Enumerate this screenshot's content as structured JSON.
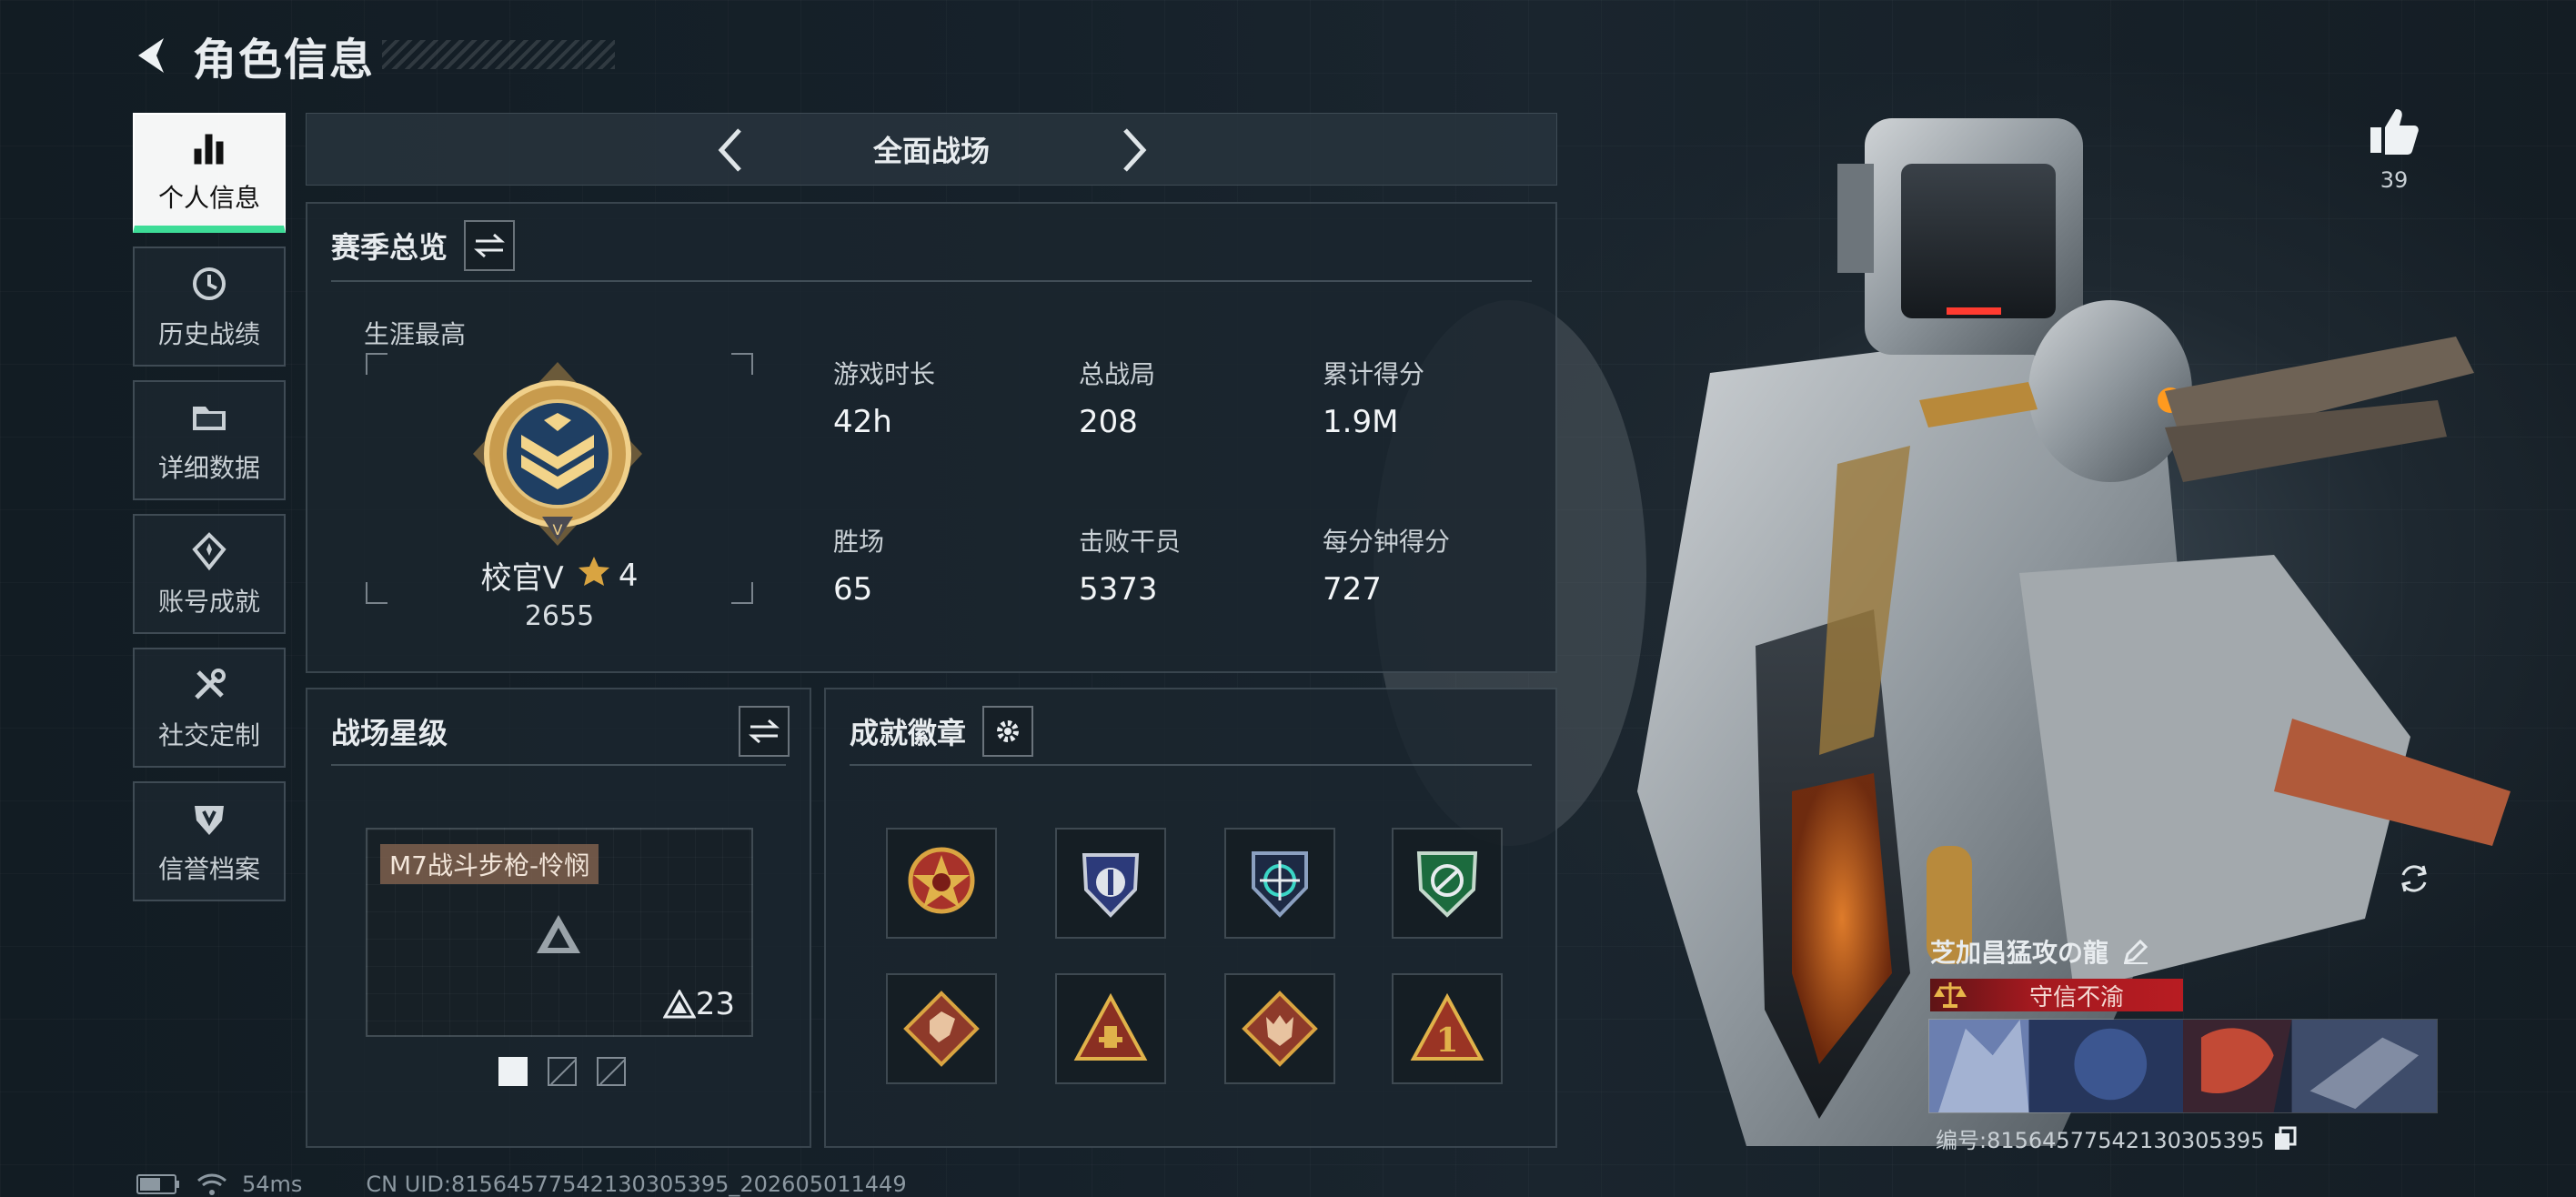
{
  "header": {
    "title": "角色信息"
  },
  "nav": {
    "items": [
      {
        "label": "个人信息",
        "icon": "bar-chart-icon"
      },
      {
        "label": "历史战绩",
        "icon": "history-icon"
      },
      {
        "label": "详细数据",
        "icon": "folder-icon"
      },
      {
        "label": "账号成就",
        "icon": "achievement-icon"
      },
      {
        "label": "社交定制",
        "icon": "tools-icon"
      },
      {
        "label": "信誉档案",
        "icon": "shield-icon"
      }
    ],
    "active_index": 0
  },
  "mode": {
    "title": "全面战场"
  },
  "season": {
    "title": "赛季总览",
    "career_label": "生涯最高",
    "rank": {
      "name": "校官V",
      "stars": "4",
      "points": "2655"
    },
    "stats": [
      {
        "label": "游戏时长",
        "value": "42h"
      },
      {
        "label": "总战局",
        "value": "208"
      },
      {
        "label": "累计得分",
        "value": "1.9M"
      },
      {
        "label": "胜场",
        "value": "65"
      },
      {
        "label": "击败干员",
        "value": "5373"
      },
      {
        "label": "每分钟得分",
        "value": "727"
      }
    ]
  },
  "star_panel": {
    "title": "战场星级",
    "weapon": {
      "name": "M7战斗步枪-怜悯",
      "level": "23"
    },
    "pager": {
      "count": 3,
      "active": 0
    }
  },
  "badges": {
    "title": "成就徽章",
    "items": [
      {
        "icon": "gold-star-medal-icon"
      },
      {
        "icon": "police-shield-badge-icon"
      },
      {
        "icon": "crosshair-shield-badge-icon"
      },
      {
        "icon": "green-shield-badge-icon"
      },
      {
        "icon": "dragon-diamond-badge-icon"
      },
      {
        "icon": "triangle-rank-badge-icon"
      },
      {
        "icon": "wolf-diamond-badge-icon"
      },
      {
        "icon": "triangle-one-badge-icon"
      }
    ]
  },
  "profile": {
    "likes": "39",
    "player_name": "芝加昌猛攻の龍",
    "title": "守信不渝",
    "id_line": "编号:81564577542130305395"
  },
  "status_bar": {
    "ping": "54ms",
    "uid_line": "CN UID:81564577542130305395_202605011449"
  },
  "colors": {
    "accent_green": "#3ddc97",
    "title_red": "#b81c22",
    "weapon_tag": "#7e604e",
    "gold": "#d9a441"
  }
}
